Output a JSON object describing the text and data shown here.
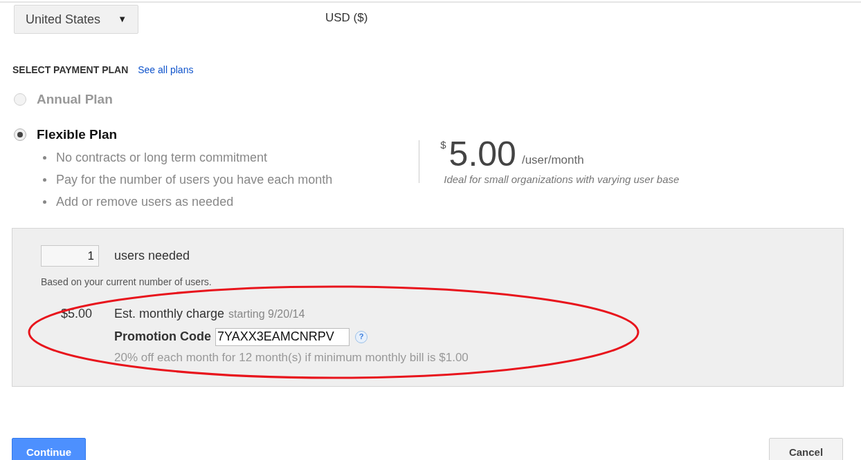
{
  "country_select": {
    "value": "United States",
    "caret": "▼"
  },
  "currency": "USD ($)",
  "payment_plan": {
    "heading": "SELECT PAYMENT PLAN",
    "link": "See all plans",
    "plans": [
      {
        "label": "Annual Plan",
        "selected": false,
        "disabled": true
      },
      {
        "label": "Flexible Plan",
        "selected": true,
        "disabled": false,
        "features": [
          "No contracts or long term commitment",
          "Pay for the number of users you have each month",
          "Add or remove users as needed"
        ]
      }
    ]
  },
  "price": {
    "currency_symbol": "$",
    "amount": "5.00",
    "unit": "/user/month",
    "note": "Ideal for small organizations with varying user base"
  },
  "order": {
    "users_value": "1",
    "users_label": "users needed",
    "users_hint": "Based on your current number of users.",
    "charge_amount": "$5.00",
    "charge_label": "Est. monthly charge",
    "charge_start": "starting 9/20/14",
    "promo_label": "Promotion Code",
    "promo_value": "7YAXX3EAMCNRPV",
    "help": "?",
    "promo_description": "20% off each month for 12 month(s) if minimum monthly bill is $1.00"
  },
  "annotation": {
    "kind": "ellipse",
    "color": "#e8141c"
  },
  "buttons": [
    {
      "label": "Continue",
      "kind": "primary"
    },
    {
      "label": "Cancel",
      "kind": "secondary"
    }
  ]
}
